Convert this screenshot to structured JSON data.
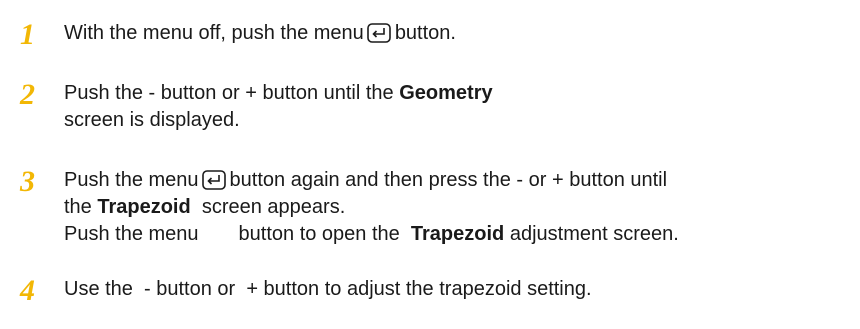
{
  "steps": [
    {
      "number": "1",
      "lines": [
        {
          "a": "With the menu off, push the menu",
          "b": "button."
        }
      ]
    },
    {
      "number": "2",
      "lines": [
        {
          "a": "Push the - button or + button until the ",
          "bold": "Geometry"
        },
        {
          "a": "screen is displayed."
        }
      ]
    },
    {
      "number": "3",
      "lines": [
        {
          "a": "Push the menu",
          "b": "button again and then press the - or + button until"
        },
        {
          "a": "the ",
          "bold": "Trapezoid",
          "c": "  screen appears."
        },
        {
          "a": "Push the menu",
          "b": "button to open the  ",
          "bold": "Trapezoid",
          "c": " adjustment screen."
        }
      ]
    },
    {
      "number": "4",
      "lines": [
        {
          "a": "Use the  - button or  + button to adjust the trapezoid setting."
        }
      ]
    }
  ],
  "icons": {
    "enter_key": "enter-return-key-icon"
  },
  "colors": {
    "step_number": "#f2b705",
    "text": "#1a1a1a"
  }
}
